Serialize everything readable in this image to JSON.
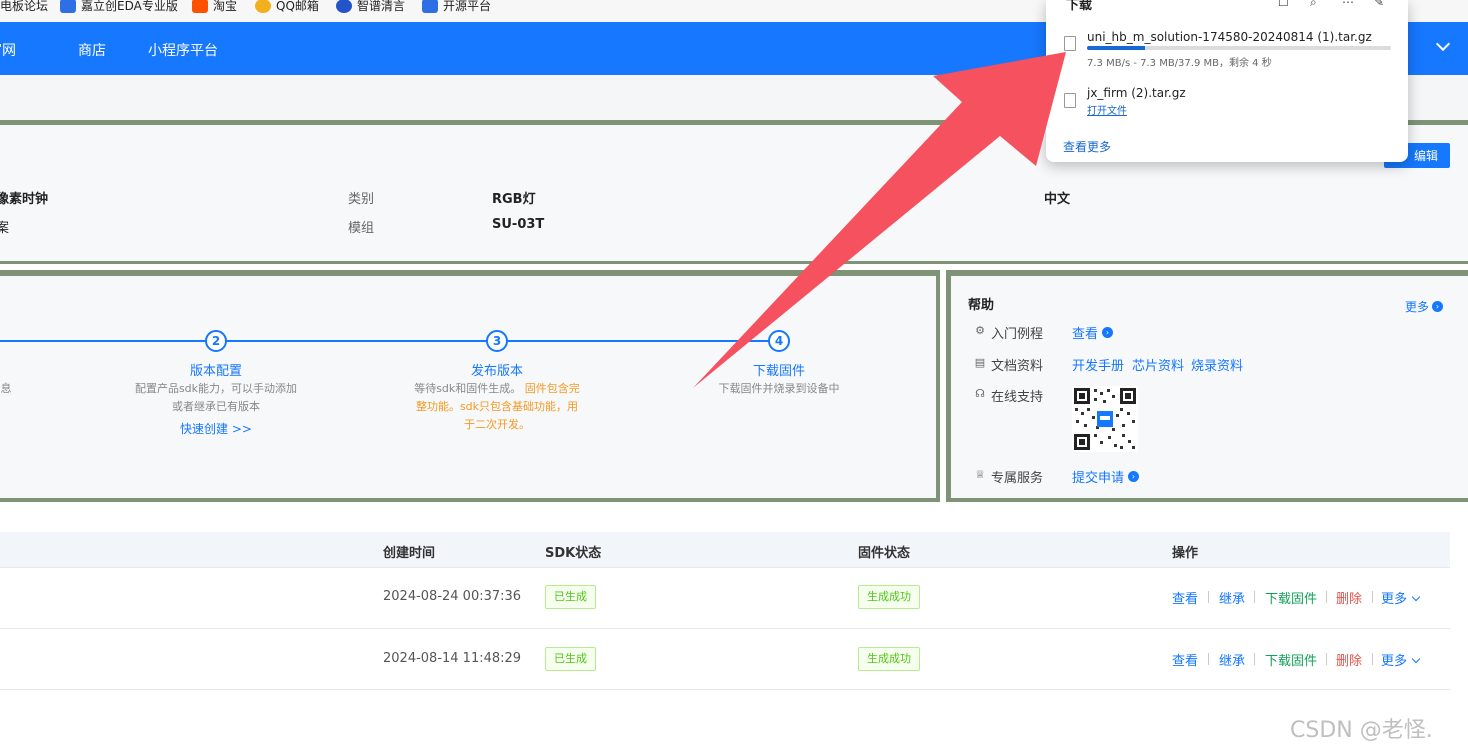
{
  "bookmarks": [
    {
      "label": "电板论坛",
      "color": "#ffffff"
    },
    {
      "label": "嘉立创EDA专业版",
      "color": "#2f6fe5"
    },
    {
      "label": "淘宝",
      "color": "#ff5000"
    },
    {
      "label": "QQ邮箱",
      "color": "#f2b01e"
    },
    {
      "label": "智谱清言",
      "color": "#2455c8"
    },
    {
      "label": "开源平台",
      "color": "#2f6fe5"
    }
  ],
  "nav": {
    "items": [
      "官网",
      "商店",
      "小程序平台"
    ]
  },
  "product": {
    "fields": [
      {
        "value": "像素时钟"
      },
      {
        "value": "案"
      },
      {
        "label": "类别",
        "value": "RGB灯"
      },
      {
        "label": "模组",
        "value": "SU-03T"
      },
      {
        "value": "中文"
      }
    ],
    "edit_label": "编辑"
  },
  "steps": [
    {
      "num": "",
      "title": "",
      "desc": "息"
    },
    {
      "num": "2",
      "title": "版本配置",
      "desc": "配置产品sdk能力，可以手动添加或者继承已有版本",
      "link": "快速创建 >>"
    },
    {
      "num": "3",
      "title": "发布版本",
      "desc_plain": "等待sdk和固件生成。",
      "desc_orange": "固件包含完整功能。sdk只包含基础功能，用于二次开发。"
    },
    {
      "num": "4",
      "title": "下载固件",
      "desc": "下载固件并烧录到设备中"
    }
  ],
  "help": {
    "title": "帮助",
    "more": "更多",
    "rows": [
      {
        "icon": "tutorial-icon",
        "label": "入门例程",
        "links": [
          "查看"
        ]
      },
      {
        "icon": "document-icon",
        "label": "文档资料",
        "links": [
          "开发手册",
          "芯片资料",
          "烧录资料"
        ]
      },
      {
        "icon": "headset-icon",
        "label": "在线支持",
        "links": []
      },
      {
        "icon": "medal-icon",
        "label": "专属服务",
        "links": [
          "提交申请"
        ]
      }
    ]
  },
  "table": {
    "headers": [
      "创建时间",
      "SDK状态",
      "固件状态",
      "操作"
    ],
    "rows": [
      {
        "time": "2024-08-24 00:37:36",
        "sdk": "已生成",
        "firmware": "生成成功"
      },
      {
        "time": "2024-08-14 11:48:29",
        "sdk": "已生成",
        "firmware": "生成成功"
      }
    ],
    "actions": {
      "view": "查看",
      "inherit": "继承",
      "download": "下载固件",
      "delete": "删除",
      "more": "更多"
    }
  },
  "downloads": {
    "title": "下载",
    "items": [
      {
        "name": "uni_hb_m_solution-174580-20240814 (1).tar.gz",
        "meta": "7.3 MB/s - 7.3 MB/37.9 MB，剩余 4 秒",
        "progress": 0.19
      },
      {
        "name": "jx_firm (2).tar.gz",
        "action": "打开文件"
      }
    ],
    "more": "查看更多"
  },
  "watermark": "CSDN @老怪.",
  "colors": {
    "primary": "#1677ff",
    "annotation_arrow": "#f5515f",
    "success": "#52c41a"
  }
}
